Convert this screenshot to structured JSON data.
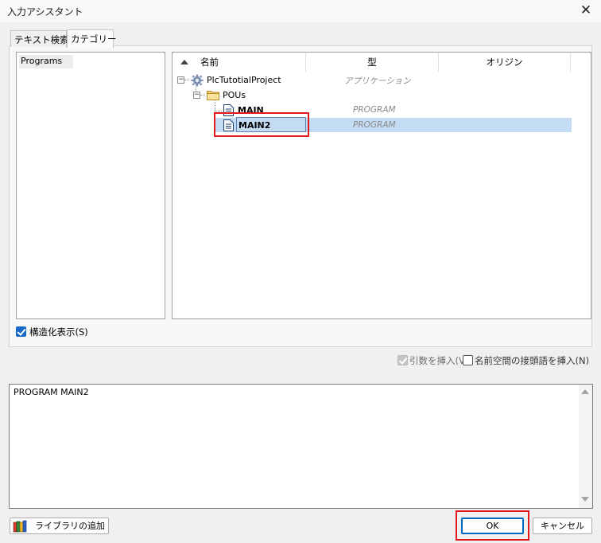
{
  "window": {
    "title": "入力アシスタント",
    "close_glyph": "✕"
  },
  "tabs": [
    {
      "label": "テキスト検索",
      "active": false
    },
    {
      "label": "カテゴリー",
      "active": true
    }
  ],
  "categories": {
    "items": [
      "Programs"
    ],
    "selected": "Programs"
  },
  "tree": {
    "columns": [
      "名前",
      "型",
      "オリジン"
    ],
    "sort_icon": "sort-ascending-icon",
    "rows": [
      {
        "name": "PlcTutotialProject",
        "type": "アプリケーション",
        "icon": "gear-icon",
        "level": 0,
        "expanded": true
      },
      {
        "name": "POUs",
        "type": "",
        "icon": "folder-icon",
        "level": 1,
        "expanded": true
      },
      {
        "name": "MAIN",
        "type": "PROGRAM",
        "icon": "document-icon",
        "level": 2
      },
      {
        "name": "MAIN2",
        "type": "PROGRAM",
        "icon": "document-icon",
        "level": 2,
        "selected": true
      }
    ],
    "selection_color": "#c4dcf3"
  },
  "options": {
    "structured_view": {
      "label": "構造化表示(S)",
      "checked": true
    },
    "insert_arguments": {
      "label": "引数を挿入(V",
      "checked": true,
      "enabled": false
    },
    "namespace_prefix": {
      "label": "名前空間の接頭語を挿入(N)",
      "checked": false
    }
  },
  "description": {
    "text": "PROGRAM MAIN2"
  },
  "buttons": {
    "add_library": "ライブラリの追加",
    "ok": "OK",
    "cancel": "キャンセル"
  },
  "colors": {
    "accent": "#0067c0",
    "highlight_box": "#e0191f",
    "checkbox_on": "#1868c8"
  }
}
